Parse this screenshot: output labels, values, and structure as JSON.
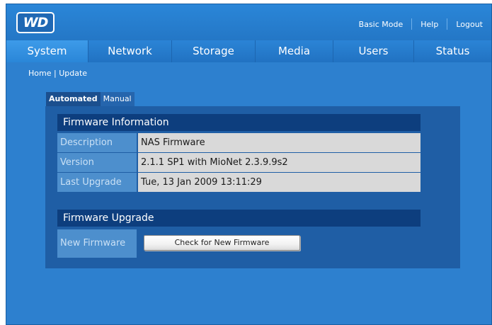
{
  "header": {
    "logo_text": "WD",
    "links": {
      "basic_mode": "Basic Mode",
      "help": "Help",
      "logout": "Logout"
    }
  },
  "nav": {
    "tabs": [
      "System",
      "Network",
      "Storage",
      "Media",
      "Users",
      "Status"
    ],
    "active": "System"
  },
  "breadcrumb": {
    "home": "Home",
    "separator": "|",
    "current": "Update"
  },
  "subtabs": {
    "automated": "Automated",
    "manual": "Manual",
    "active": "Automated"
  },
  "firmware_info": {
    "title": "Firmware Information",
    "rows": [
      {
        "label": "Description",
        "value": "NAS Firmware"
      },
      {
        "label": "Version",
        "value": "2.1.1 SP1 with MioNet 2.3.9.9s2"
      },
      {
        "label": "Last Upgrade",
        "value": "Tue, 13 Jan 2009 13:11:29"
      }
    ]
  },
  "firmware_upgrade": {
    "title": "Firmware Upgrade",
    "label": "New Firmware",
    "button": "Check for New Firmware"
  },
  "colors": {
    "background": "#2d80cf",
    "panel": "#1f5ea5",
    "section_header": "#0d3e7e",
    "label_cell": "#4d8fcd",
    "value_cell": "#d9d9d9"
  }
}
